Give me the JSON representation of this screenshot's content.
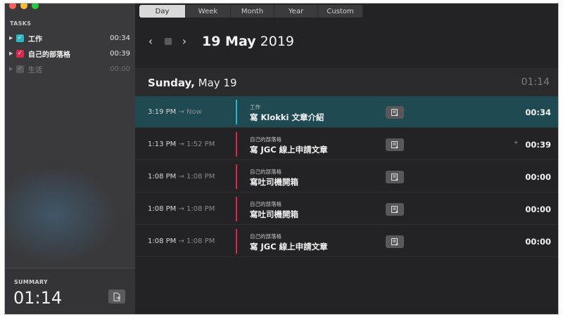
{
  "sidebar": {
    "tasks_heading": "TASKS",
    "tasks": [
      {
        "name": "工作",
        "time": "00:34",
        "color": "#2bb6c4",
        "checked": true,
        "dim": false
      },
      {
        "name": "自己的部落格",
        "time": "00:39",
        "color": "#e0254c",
        "checked": true,
        "dim": false
      },
      {
        "name": "生活",
        "time": "00:00",
        "color": "#6e6e70",
        "checked": true,
        "dim": true
      }
    ],
    "summary_label": "SUMMARY",
    "summary_time": "01:14"
  },
  "views": [
    "Day",
    "Week",
    "Month",
    "Year",
    "Custom"
  ],
  "active_view": "Day",
  "date_title": {
    "day_month": "19 May",
    "year": "2019"
  },
  "day_header": {
    "weekday": "Sunday,",
    "date": "May 19",
    "total": "01:14"
  },
  "entries": [
    {
      "start": "3:19 PM",
      "end": "Now",
      "project": "工作",
      "title": "寫 Klokki 文章介紹",
      "duration": "00:34",
      "color": "#2bb6c4",
      "active": true
    },
    {
      "start": "1:13 PM",
      "end": "1:52 PM",
      "project": "自己的部落格",
      "title": "寫 JGC 線上申請文章",
      "duration": "00:39",
      "color": "#e0254c",
      "active": false
    },
    {
      "start": "1:08 PM",
      "end": "1:08 PM",
      "project": "自己的部落格",
      "title": "寫吐司機開箱",
      "duration": "00:00",
      "color": "#e0254c",
      "active": false
    },
    {
      "start": "1:08 PM",
      "end": "1:08 PM",
      "project": "自己的部落格",
      "title": "寫吐司機開箱",
      "duration": "00:00",
      "color": "#e0254c",
      "active": false
    },
    {
      "start": "1:08 PM",
      "end": "1:08 PM",
      "project": "自己的部落格",
      "title": "寫 JGC 線上申請文章",
      "duration": "00:00",
      "color": "#e0254c",
      "active": false
    }
  ],
  "icons": {
    "add_note": "note-add-icon",
    "export": "export-icon",
    "back": "chevron-left-icon",
    "forward": "chevron-right-icon"
  }
}
